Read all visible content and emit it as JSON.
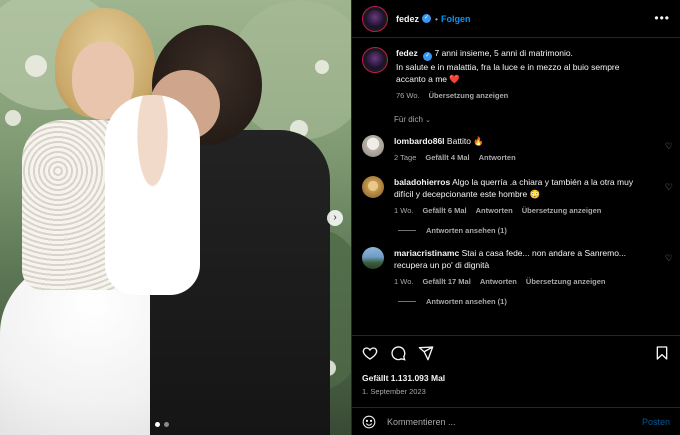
{
  "header": {
    "username": "fedez",
    "verified_icon": "verified-badge-icon",
    "follow_label": "Folgen",
    "more_icon": "more-options-icon"
  },
  "caption": {
    "username": "fedez",
    "text_line1": "7 anni insieme, 5 anni di matrimonio.",
    "text_line2": "In salute e in malattia, fra la luce e in mezzo al buio sempre",
    "text_line3": "accanto a me",
    "heart": "❤️",
    "time": "76 Wo.",
    "translate": "Übersetzung anzeigen"
  },
  "for_you_label": "Für dich",
  "comments": [
    {
      "username": "lombardo86l",
      "text": "Battito",
      "emoji": "🔥",
      "time": "2 Tage",
      "likes": "Gefällt 4 Mal",
      "reply": "Antworten"
    },
    {
      "username": "baladohierros",
      "text": "Algo la querría .a chiara y también a la otra muy difícil y decepcionante este hombre",
      "emoji": "😳",
      "time": "1 Wo.",
      "likes": "Gefällt 6 Mal",
      "reply": "Antworten",
      "translate": "Übersetzung anzeigen",
      "view_replies": "Antworten ansehen (1)"
    },
    {
      "username": "mariacristinamc",
      "text": "Stai a casa fede... non andare a Sanremo... recupera un po' di dignità",
      "time": "1 Wo.",
      "likes": "Gefällt 17 Mal",
      "reply": "Antworten",
      "translate": "Übersetzung anzeigen",
      "view_replies": "Antworten ansehen (1)"
    }
  ],
  "actions": {
    "likes": "Gefällt 1.131.093 Mal",
    "date": "1. September 2023"
  },
  "comment_input": {
    "placeholder": "Kommentieren ...",
    "post_label": "Posten"
  },
  "colors": {
    "accent": "#0095f6",
    "background": "#000000",
    "secondary_text": "#a8a8a8",
    "heart": "#ed4956"
  }
}
